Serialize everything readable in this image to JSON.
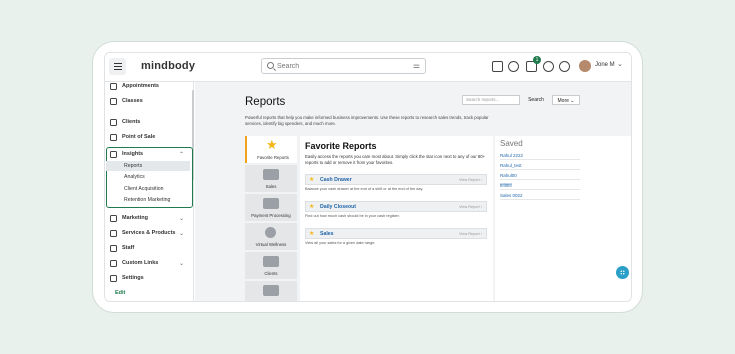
{
  "topbar": {
    "app_name": "mindbody",
    "search_placeholder": "Search",
    "notification_count": "1",
    "user_name": "Jone M"
  },
  "sidebar": {
    "items": [
      {
        "label": "Appointments"
      },
      {
        "label": "Classes"
      },
      {
        "label": "Clients"
      },
      {
        "label": "Point of Sale"
      },
      {
        "label": "Insights"
      },
      {
        "label": "Marketing"
      },
      {
        "label": "Services & Products"
      },
      {
        "label": "Staff"
      },
      {
        "label": "Custom Links"
      },
      {
        "label": "Settings"
      }
    ],
    "insights_sub": [
      "Reports",
      "Analytics",
      "Client Acquisition",
      "Retention Marketing"
    ],
    "active_sub": "Reports",
    "edit_label": "Edit"
  },
  "reports": {
    "title": "Reports",
    "search_placeholder": "Search reports...",
    "search_button": "Search",
    "more_button": "More",
    "description": "Powerful reports that help you make informed business improvements. Use these reports to research sales trends, track popular services, identify big spenders, and much more.",
    "categories": [
      "Favorite Reports",
      "Sales",
      "Payment Processing",
      "Virtual Wellness",
      "Clients"
    ],
    "favorites_title": "Favorite Reports",
    "favorites_desc": "Easily access the reports you care most about. Simply click the star icon next to any of our 80+ reports to add or remove it from your favorites.",
    "favorite_items": [
      {
        "name": "Cash Drawer",
        "view": "View Report",
        "desc": "Balance your cash drawer at the end of a shift or at the end of the day."
      },
      {
        "name": "Daily Closeout",
        "view": "View Report",
        "desc": "Find out how much cash should be in your cash register."
      },
      {
        "name": "Sales",
        "view": "View Report",
        "desc": "View all your sales for a given date range."
      }
    ],
    "saved_title": "Saved",
    "saved_items": [
      "Rahul 2222",
      "Rahul_test",
      "Rahul00",
      "ffffffffff",
      "Sales 0022"
    ]
  },
  "colors": {
    "accent_green": "#1f7a4d",
    "star_yellow": "#f5b715",
    "link_blue": "#2266aa",
    "background_mint": "#e8f1ec"
  }
}
